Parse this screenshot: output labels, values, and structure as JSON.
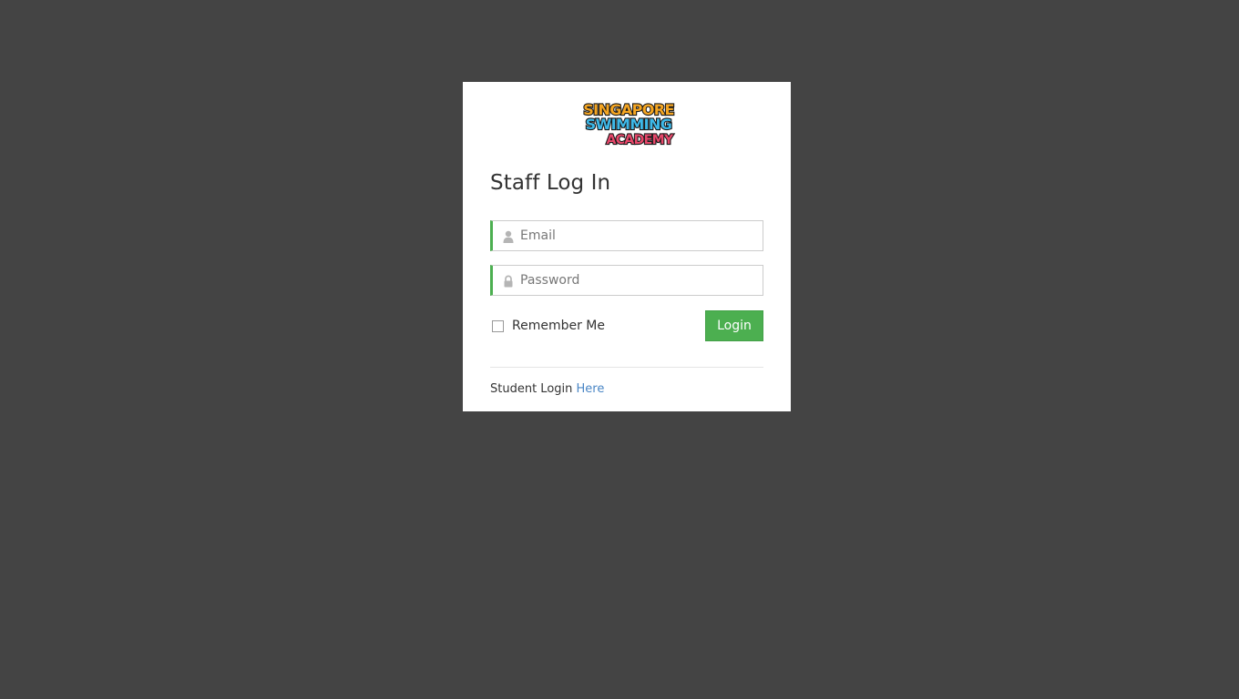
{
  "brand": {
    "logo_lines": [
      "SINGAPORE",
      "SWIMMING",
      "ACADEMY"
    ]
  },
  "login": {
    "title": "Staff Log In",
    "email_placeholder": "Email",
    "password_placeholder": "Password",
    "remember_label": "Remember Me",
    "remember_checked": false,
    "submit_label": "Login"
  },
  "footer": {
    "text": "Student Login",
    "link_label": "Here"
  },
  "icons": {
    "email": "user-icon",
    "password": "lock-icon"
  },
  "colors": {
    "background": "#444444",
    "accent": "#4caf50",
    "link": "#4a86c5"
  }
}
